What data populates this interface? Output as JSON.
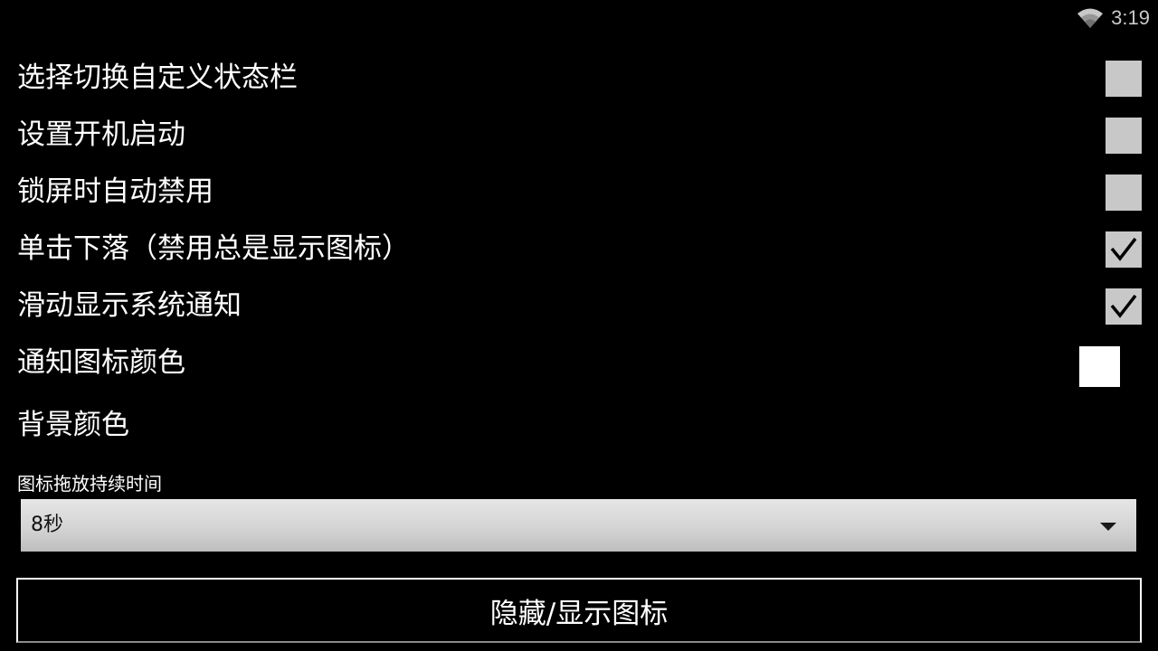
{
  "status_bar": {
    "time": "3:19",
    "wifi_icon": "wifi-icon"
  },
  "settings": [
    {
      "label": "选择切换自定义状态栏",
      "checked": false
    },
    {
      "label": "设置开机启动",
      "checked": false
    },
    {
      "label": "锁屏时自动禁用",
      "checked": false
    },
    {
      "label": "单击下落（禁用总是显示图标）",
      "checked": true
    },
    {
      "label": "滑动显示系统通知",
      "checked": true
    }
  ],
  "notification_icon_color": {
    "label": "通知图标颜色",
    "color": "#ffffff"
  },
  "background_color": {
    "label": "背景颜色"
  },
  "drag_duration": {
    "label": "图标拖放持续时间",
    "selected": "8秒"
  },
  "toggle_button": {
    "label": "隐藏/显示图标"
  },
  "colors": {
    "background": "#000000",
    "checkbox": "#c8c8c8",
    "text": "#ffffff"
  }
}
